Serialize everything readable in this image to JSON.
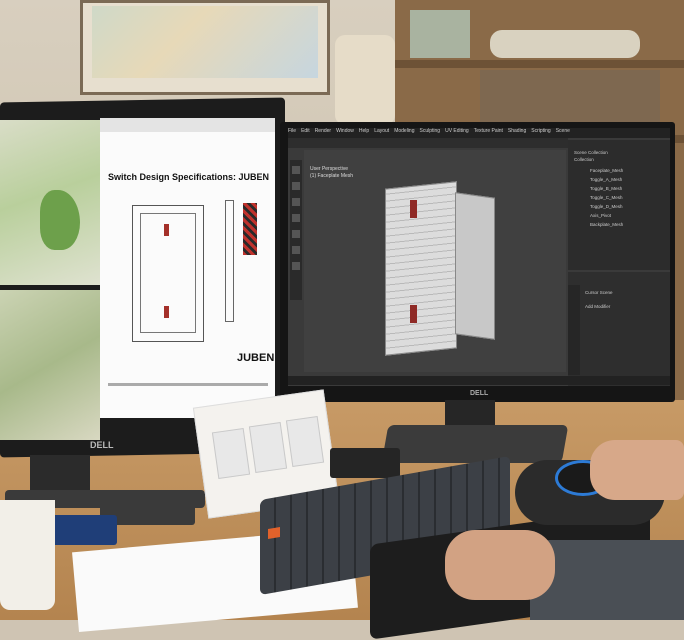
{
  "scene": {
    "left_monitor": {
      "document": {
        "title": "Switch Design Specifications: JUBEN",
        "logo": "JUBEN"
      },
      "brand": "DELL"
    },
    "right_monitor": {
      "app": "Blender",
      "menu": [
        "File",
        "Edit",
        "Render",
        "Window",
        "Help",
        "Layout",
        "Modeling",
        "Sculpting",
        "UV Editing",
        "Texture Paint",
        "Shading",
        "Scripting",
        "Scene"
      ],
      "viewport_label_lines": [
        "User Perspective",
        "(1) Faceplate Mesh"
      ],
      "outliner_items": [
        "Scene Collection",
        "Collection",
        "Faceplate_Mesh",
        "Toggle_A_Mesh",
        "Toggle_B_Mesh",
        "Toggle_C_Mesh",
        "Toggle_D_Mesh",
        "Axis_Pivot",
        "Backplate_Mesh"
      ],
      "properties_items": [
        "Cursor Scene",
        "Add Modifier"
      ],
      "brand": "DELL"
    }
  }
}
